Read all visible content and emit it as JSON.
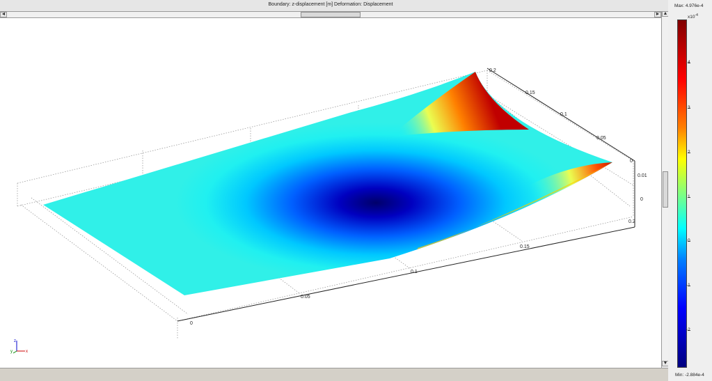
{
  "window": {
    "title": "Boundary: z-displacement [m]   Deformation: Displacement"
  },
  "scroll": {
    "left_arrow": "◄",
    "right_arrow": "►",
    "up_arrow": "▲",
    "down_arrow": "▼"
  },
  "plot": {
    "x_ticks": [
      "0",
      "0.05",
      "0.1",
      "0.15",
      "0.2"
    ],
    "y_ticks": [
      "0",
      "0.05",
      "0.1",
      "0.15",
      "0.2"
    ],
    "z_ticks": [
      "0",
      "0.01"
    ],
    "triad": {
      "z": "z",
      "y": "y",
      "x": "x"
    }
  },
  "colorbar": {
    "max_label": "Max: 4.976e-4",
    "min_label": "Min: -2.884e-4",
    "scale_label": "x10",
    "scale_exp": "-4",
    "ticks": [
      "4",
      "3",
      "2",
      "1",
      "0",
      "-1",
      "-2"
    ],
    "colors": [
      "#7f0000",
      "#ff0000",
      "#ff8000",
      "#ffff00",
      "#80ff80",
      "#00ffff",
      "#0080ff",
      "#0000ff",
      "#00007f"
    ]
  }
}
